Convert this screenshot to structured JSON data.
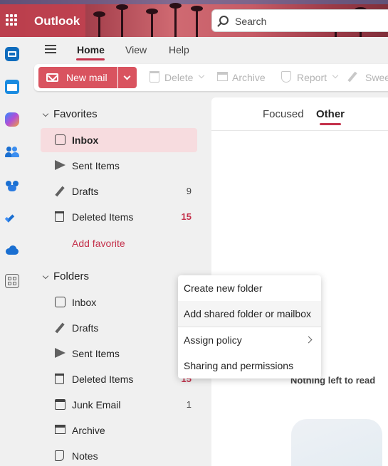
{
  "app": {
    "name": "Outlook",
    "accent": "#c4314b"
  },
  "search": {
    "placeholder": "Search"
  },
  "ribbon": {
    "tabs": [
      {
        "label": "Home",
        "active": true
      },
      {
        "label": "View",
        "active": false
      },
      {
        "label": "Help",
        "active": false
      }
    ],
    "toolbar": {
      "new_mail": "New mail",
      "delete": "Delete",
      "archive": "Archive",
      "report": "Report",
      "sweep": "Swee"
    }
  },
  "rail": {
    "icons": [
      "mail-icon",
      "calendar-icon",
      "copilot-icon",
      "people-icon",
      "teams-icon",
      "todo-icon",
      "onedrive-icon",
      "apps-icon"
    ]
  },
  "favorites": {
    "heading": "Favorites",
    "items": [
      {
        "label": "Inbox",
        "count": "",
        "icon": "inbox-icon",
        "selected": true
      },
      {
        "label": "Sent Items",
        "count": "",
        "icon": "send-icon"
      },
      {
        "label": "Drafts",
        "count": "9",
        "icon": "pencil-icon"
      },
      {
        "label": "Deleted Items",
        "count": "15",
        "icon": "trash-icon",
        "count_style": "red"
      }
    ],
    "add_favorite": "Add favorite"
  },
  "folders": {
    "heading": "Folders",
    "items": [
      {
        "label": "Inbox",
        "count": "",
        "icon": "inbox-icon"
      },
      {
        "label": "Drafts",
        "count": "",
        "icon": "pencil-icon"
      },
      {
        "label": "Sent Items",
        "count": "",
        "icon": "send-icon"
      },
      {
        "label": "Deleted Items",
        "count": "15",
        "icon": "trash-icon",
        "count_style": "red"
      },
      {
        "label": "Junk Email",
        "count": "1",
        "icon": "junk-icon"
      },
      {
        "label": "Archive",
        "count": "",
        "icon": "archive-icon"
      },
      {
        "label": "Notes",
        "count": "",
        "icon": "note-icon"
      }
    ]
  },
  "message_list": {
    "tabs": [
      {
        "label": "Focused",
        "active": false
      },
      {
        "label": "Other",
        "active": true
      }
    ],
    "empty_text": "Nothing left to read"
  },
  "context_menu": {
    "items": [
      {
        "label": "Create new folder"
      },
      {
        "label": "Add shared folder or mailbox",
        "hover": true
      },
      {
        "label": "Assign policy",
        "submenu": true
      },
      {
        "label": "Sharing and permissions"
      }
    ]
  }
}
